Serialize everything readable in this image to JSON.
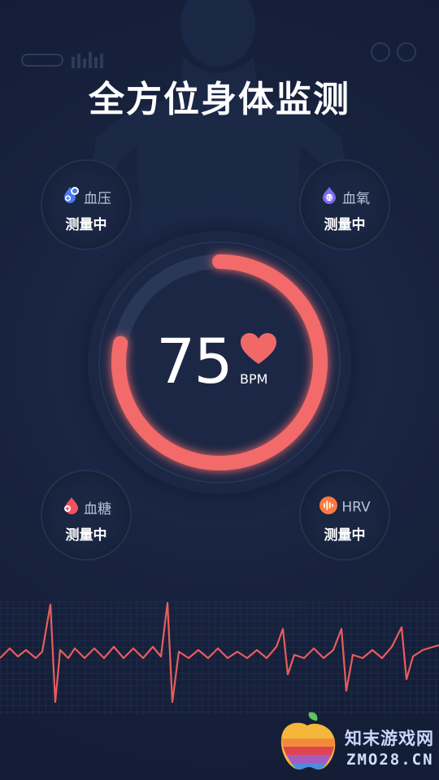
{
  "header": {
    "title": "全方位身体监测"
  },
  "metrics": {
    "blood_pressure": {
      "label": "血压",
      "status": "测量中",
      "icon": "blood-pressure-icon",
      "color": "#4a78f2"
    },
    "blood_oxygen": {
      "label": "血氧",
      "status": "测量中",
      "icon": "blood-oxygen-icon",
      "color": "#7a6bf0"
    },
    "blood_sugar": {
      "label": "血糖",
      "status": "测量中",
      "icon": "blood-sugar-icon",
      "color": "#f0525e"
    },
    "hrv": {
      "label": "HRV",
      "status": "测量中",
      "icon": "hrv-icon",
      "color": "#ff7a3c"
    }
  },
  "heart_rate": {
    "value": "75",
    "unit": "BPM",
    "progress": 0.78,
    "accent": "#f26b6b"
  },
  "watermark": {
    "cn": "知末游戏网",
    "en": "ZMO28.CN"
  }
}
